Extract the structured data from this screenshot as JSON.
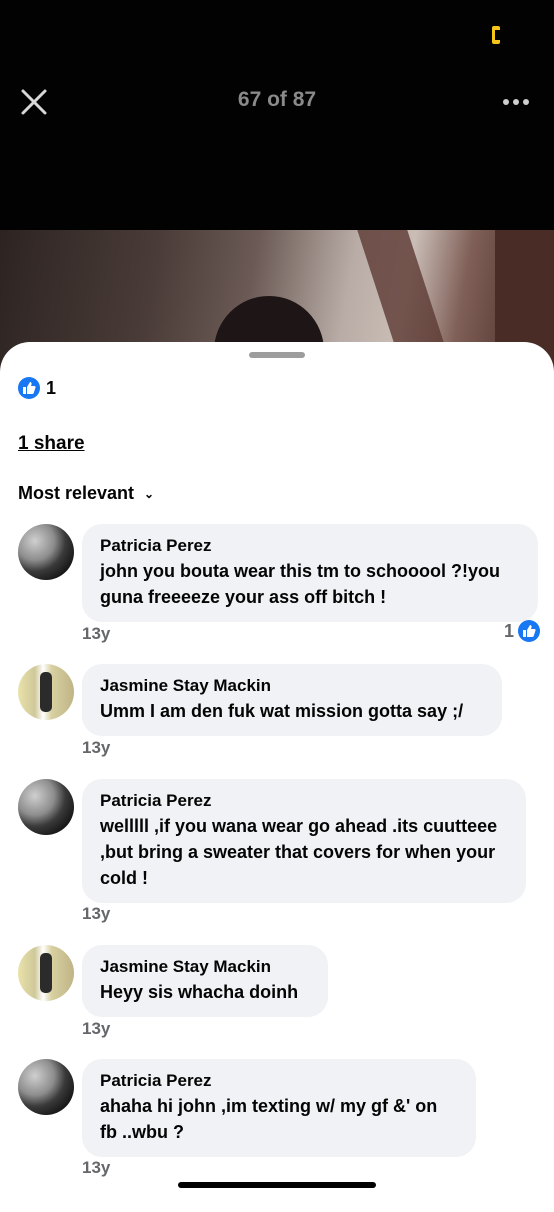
{
  "header": {
    "counter": "67 of 87"
  },
  "reactions": {
    "count": "1",
    "shares_label": "1 share"
  },
  "sort": {
    "label": "Most relevant"
  },
  "comments": [
    {
      "author": "Patricia Perez",
      "text": "john you bouta wear this tm to schooool ?!you guna freeeeze your ass off bitch !",
      "time": "13y",
      "likes": "1"
    },
    {
      "author": "Jasmine Stay Mackin",
      "text": "Umm I am den fuk wat mission gotta say ;/",
      "time": "13y"
    },
    {
      "author": "Patricia Perez",
      "text": "welllll ,if you wana wear go ahead .its cuutteee ,but bring a sweater that covers for when your cold !",
      "time": "13y"
    },
    {
      "author": "Jasmine Stay Mackin",
      "text": "Heyy sis whacha doinh",
      "time": "13y"
    },
    {
      "author": "Patricia Perez",
      "text": "ahaha hi john ,im texting w/ my gf &' on fb ..wbu ?",
      "time": "13y"
    }
  ],
  "icons": {
    "close": "close-icon",
    "more": "more-icon",
    "like": "thumbs-up-icon",
    "sort": "chevron-down-icon"
  },
  "colors": {
    "accent": "#1877f2",
    "bubble": "#f0f2f5",
    "meta": "#65676b"
  }
}
